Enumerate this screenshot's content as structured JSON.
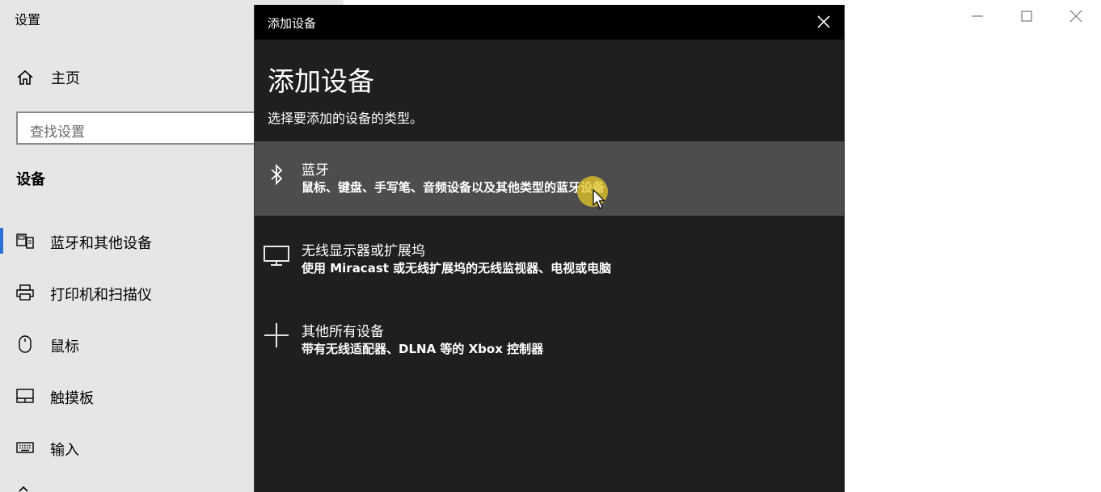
{
  "window": {
    "title": "设置"
  },
  "sidebar": {
    "home_label": "主页",
    "search_placeholder": "查找设置",
    "section_heading": "设备",
    "items": [
      {
        "label": "蓝牙和其他设备",
        "icon": "bluetooth-devices-icon",
        "active": true
      },
      {
        "label": "打印机和扫描仪",
        "icon": "printer-icon",
        "active": false
      },
      {
        "label": "鼠标",
        "icon": "mouse-icon",
        "active": false
      },
      {
        "label": "触摸板",
        "icon": "touchpad-icon",
        "active": false
      },
      {
        "label": "输入",
        "icon": "keyboard-icon",
        "active": false
      }
    ]
  },
  "dialog": {
    "titlebar": "添加设备",
    "heading": "添加设备",
    "subtitle": "选择要添加的设备的类型。",
    "options": [
      {
        "title": "蓝牙",
        "description": "鼠标、键盘、手写笔、音频设备以及其他类型的蓝牙设备",
        "icon": "bluetooth-icon",
        "selected": true
      },
      {
        "title": "无线显示器或扩展坞",
        "description": "使用 Miracast 或无线扩展坞的无线监视器、电视或电脑",
        "icon": "monitor-icon",
        "selected": false
      },
      {
        "title": "其他所有设备",
        "description": "带有无线适配器、DLNA 等的 Xbox 控制器",
        "icon": "plus-icon",
        "selected": false
      }
    ]
  },
  "colors": {
    "sidebar_bg": "#e6e6e6",
    "dialog_bg": "#1f1f1f",
    "dialog_titlebar_bg": "#000000",
    "selected_option_bg": "#4d4d4d",
    "accent": "#2b6fd6",
    "cursor_highlight": "#e6c828"
  }
}
